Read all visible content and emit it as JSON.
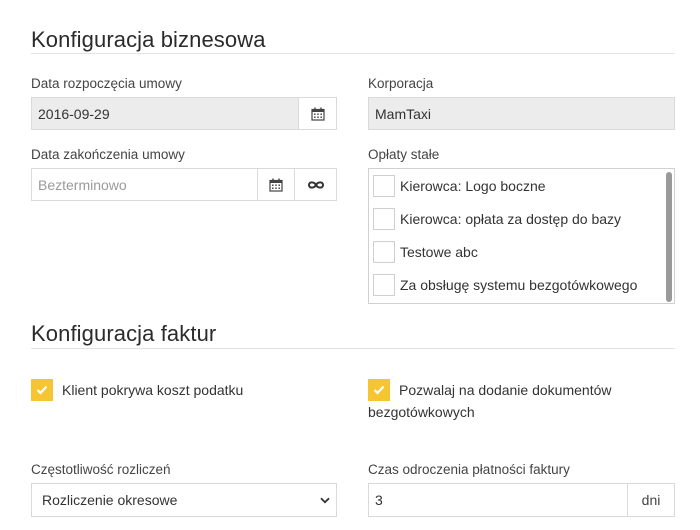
{
  "business": {
    "title": "Konfiguracja biznesowa",
    "start_label": "Data rozpoczęcia umowy",
    "start_value": "2016-09-29",
    "end_label": "Data zakończenia umowy",
    "end_placeholder": "Bezterminowo",
    "corp_label": "Korporacja",
    "corp_value": "MamTaxi",
    "fees_label": "Opłaty stałe",
    "fees": [
      "Kierowca: Logo boczne",
      "Kierowca: opłata za dostęp do bazy",
      "Testowe abc",
      "Za obsługę systemu bezgotówkowego"
    ]
  },
  "invoice": {
    "title": "Konfiguracja faktur",
    "tax_label": "Klient pokrywa koszt podatku",
    "docs_label_line1": "Pozwalaj na dodanie dokumentów",
    "docs_label_line2": "bezgotówkowych",
    "freq_label": "Częstotliwość rozliczeń",
    "freq_value": "Rozliczenie okresowe",
    "delay_label": "Czas odroczenia płatności faktury",
    "delay_value": "3",
    "delay_unit": "dni"
  },
  "icons": {
    "calendar": "calendar-icon",
    "infinity": "infinity-icon",
    "check": "check-icon",
    "chevron": "chevron-down-icon"
  },
  "colors": {
    "checked": "#f6c532",
    "readonly_bg": "#ececec"
  }
}
